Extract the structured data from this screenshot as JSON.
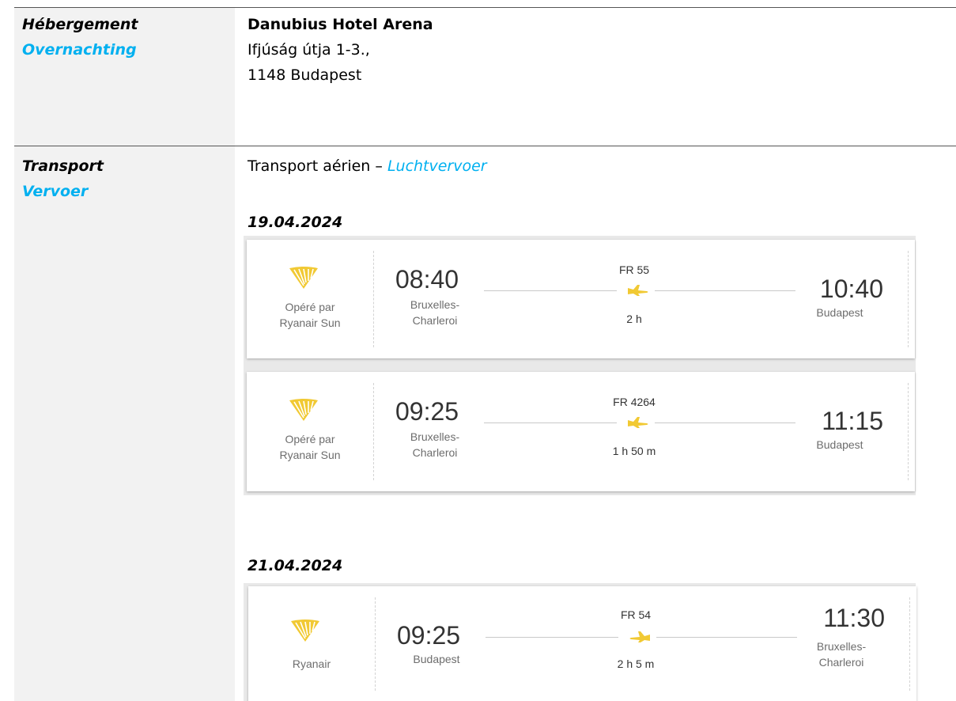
{
  "accommodation": {
    "label_fr": "Hébergement",
    "label_nl": "Overnachting",
    "hotel_name": "Danubius Hotel Arena",
    "address_line1": "Ifjúság útja 1-3.,",
    "address_line2": "1148 Budapest"
  },
  "transport": {
    "label_fr": "Transport",
    "label_nl": "Vervoer",
    "mode_fr": "Transport aérien – ",
    "mode_nl": "Luchtvervoer",
    "outbound_date": "19.04.2024",
    "return_date": "21.04.2024",
    "flights": [
      {
        "operator_line1": "Opéré par",
        "operator_line2": "Ryanair Sun",
        "dep_time": "08:40",
        "dep_city_line1": "Bruxelles-",
        "dep_city_line2": "Charleroi",
        "flight_no": "FR 55",
        "duration": "2 h",
        "arr_time": "10:40",
        "arr_city_line1": "Budapest",
        "arr_city_line2": ""
      },
      {
        "operator_line1": "Opéré par",
        "operator_line2": "Ryanair Sun",
        "dep_time": "09:25",
        "dep_city_line1": "Bruxelles-",
        "dep_city_line2": "Charleroi",
        "flight_no": "FR 4264",
        "duration": "1 h 50 m",
        "arr_time": "11:15",
        "arr_city_line1": "Budapest",
        "arr_city_line2": ""
      },
      {
        "operator_line1": "Ryanair",
        "operator_line2": "",
        "dep_time": "09:25",
        "dep_city_line1": "Budapest",
        "dep_city_line2": "",
        "flight_no": "FR 54",
        "duration": "2 h 5 m",
        "arr_time": "11:30",
        "arr_city_line1": "Bruxelles-",
        "arr_city_line2": "Charleroi"
      }
    ]
  },
  "colors": {
    "accent_dutch": "#00b0f0",
    "ryanair_gold": "#f1c933",
    "label_cell_bg": "#f2f2f2"
  },
  "icons": {
    "airline_logo": "ryanair-harp-icon",
    "plane": "airplane-icon"
  }
}
